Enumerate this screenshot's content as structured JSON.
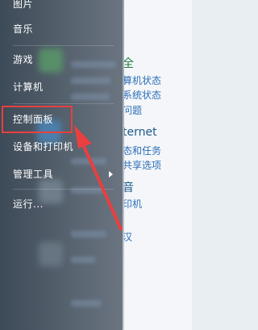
{
  "start_menu": {
    "items": [
      {
        "label": "图片"
      },
      {
        "label": "音乐"
      },
      {
        "label": "游戏"
      },
      {
        "label": "计算机"
      },
      {
        "label": "控制面板"
      },
      {
        "label": "设备和打印机"
      },
      {
        "label": "管理工具"
      },
      {
        "label": "运行..."
      }
    ]
  },
  "control_panel": {
    "section1_heading": "全",
    "section1_links": [
      "系统状态",
      "算机状态",
      "问题"
    ],
    "section2_heading": "ternet",
    "section2_links": [
      "态和任务",
      "共享选项"
    ],
    "section3_heading": "音",
    "section3_links": [
      "印机"
    ],
    "section4_links": [
      "汉"
    ]
  },
  "annotation": {
    "highlight_color": "#e84040",
    "arrow_color": "#e84040"
  }
}
